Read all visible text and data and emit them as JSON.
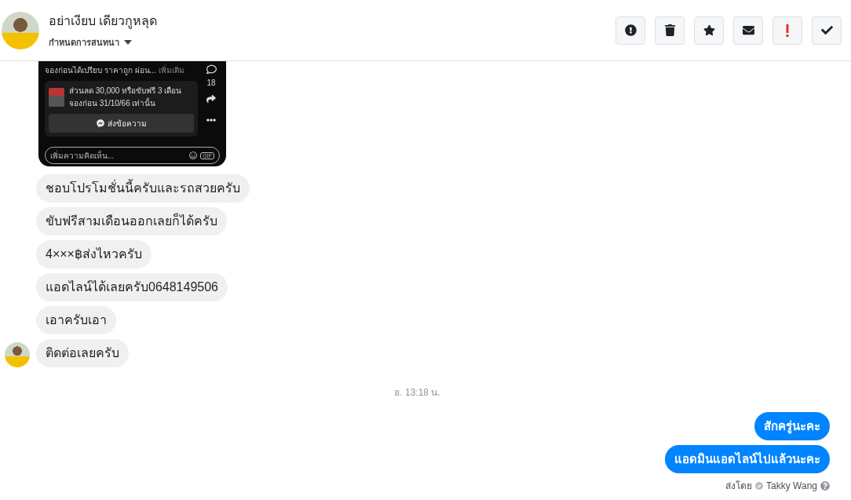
{
  "header": {
    "name": "อย่าเงียบ เดียวกูหลุด",
    "subtitle": "กำหนดการสนทนา",
    "actions": [
      {
        "kind": "alert"
      },
      {
        "kind": "trash"
      },
      {
        "kind": "star"
      },
      {
        "kind": "mail"
      },
      {
        "kind": "important"
      },
      {
        "kind": "done"
      }
    ]
  },
  "post_preview": {
    "caption": "จองก่อนได้เปรียบ ราคาถูก ผ่อน...",
    "more_link": "เพิ่มเติม",
    "comment_count": "18",
    "promo_text": "ส่วนลด 30,000 หรือขับฟรี 3 เดือน จองก่อน 31/10/66 เท่านั้น",
    "send_button": "ส่งข้อความ",
    "comment_placeholder": "เพิ่มความคิดเห็น...",
    "gif_label": "GIF"
  },
  "thread": [
    {
      "kind": "incoming",
      "text": "ชอบโปรโมชั่นนี้ครับและรถสวยครับ",
      "avatar": false
    },
    {
      "kind": "incoming",
      "text": "ขับฟรีสามเดือนออกเลยก็ได้ครับ",
      "avatar": false
    },
    {
      "kind": "incoming",
      "text": "4×××฿ส่งไหวครับ",
      "avatar": false
    },
    {
      "kind": "incoming",
      "text": "แอดไลน์ได้เลยครับ0648149506",
      "avatar": false
    },
    {
      "kind": "incoming",
      "text": "เอาครับเอา",
      "avatar": false
    },
    {
      "kind": "incoming",
      "text": "ติดต่อเลยครับ",
      "avatar": true
    },
    {
      "kind": "timestamp",
      "text": "อ. 13:18 น."
    },
    {
      "kind": "outgoing",
      "text": "สักครู่นะคะ"
    },
    {
      "kind": "outgoing",
      "text": "แอดมินแอดไลน์ไปแล้วนะคะ"
    },
    {
      "kind": "sent_by",
      "label": "ส่งโดย",
      "name": "Takky Wang"
    }
  ]
}
